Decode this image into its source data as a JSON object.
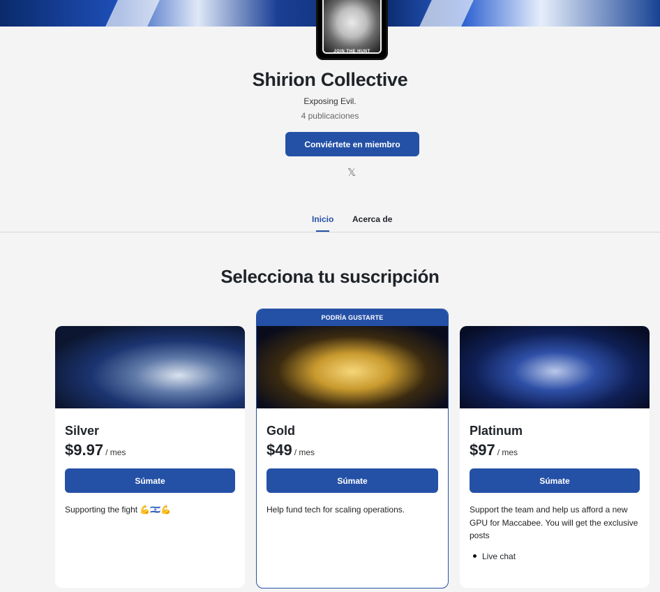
{
  "header": {
    "avatar_caption": "JOIN THE HUNT",
    "title": "Shirion Collective",
    "tagline": "Exposing Evil.",
    "post_count": "4 publicaciones",
    "member_button": "Conviértete en miembro",
    "social_icon": "x-logo-icon"
  },
  "tabs": [
    {
      "label": "Inicio",
      "active": true
    },
    {
      "label": "Acerca de",
      "active": false
    }
  ],
  "section": {
    "title": "Selecciona tu suscripción"
  },
  "tiers": [
    {
      "name": "Silver",
      "price": "$9.97",
      "period": "/ mes",
      "button": "Súmate",
      "description": "Supporting the fight 💪🇮🇱💪"
    },
    {
      "badge": "PODRÍA GUSTARTE",
      "name": "Gold",
      "price": "$49",
      "period": "/ mes",
      "button": "Súmate",
      "description": "Help fund tech for scaling operations."
    },
    {
      "name": "Platinum",
      "price": "$97",
      "period": "/ mes",
      "button": "Súmate",
      "description": "Support the team and help us afford a new GPU for Maccabee. You will get the exclusive posts",
      "benefits": [
        "Live chat"
      ]
    }
  ],
  "colors": {
    "accent": "#2451a6",
    "background": "#f4f4f4"
  }
}
